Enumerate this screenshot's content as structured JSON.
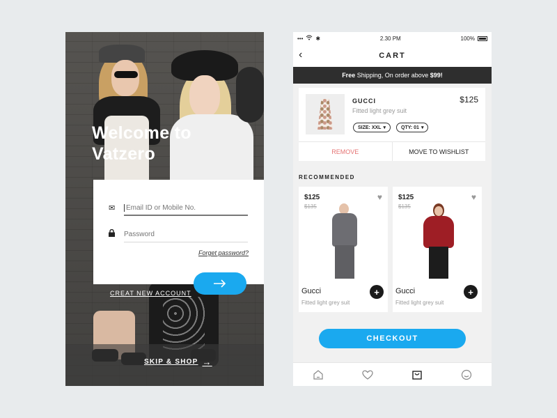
{
  "login": {
    "welcome_line1": "Welcome to",
    "welcome_line2": "Vatzero",
    "email_placeholder": "Email ID or Mobile No.",
    "password_placeholder": "Password",
    "forgot_label": "Forget password?",
    "submit_icon": "arrow-right-icon",
    "create_account_label": "CREAT NEW ACCOUNT",
    "skip_label": "SKIP & SHOP"
  },
  "status_bar": {
    "time": "2.30 PM",
    "battery": "100%"
  },
  "cart": {
    "title": "CART",
    "banner_bold1": "Free",
    "banner_text": " Shipping, On order above ",
    "banner_bold2": "$99!",
    "item": {
      "brand": "GUCCI",
      "description": "Fitted light grey suit",
      "price": "$125",
      "size_label": "SIZE: XXL",
      "qty_label": "QTY: 01",
      "remove_label": "REMOVE",
      "wishlist_label": "MOVE TO WISHLIST"
    },
    "recommended_label": "RECOMMENDED",
    "recommended": [
      {
        "price": "$125",
        "old_price": "$135",
        "name": "Gucci",
        "description": "Fitted light grey suit"
      },
      {
        "price": "$125",
        "old_price": "$135",
        "name": "Gucci",
        "description": "Fitted light grey suit"
      }
    ],
    "checkout_label": "CHECKOUT"
  },
  "tabs": [
    "home-icon",
    "heart-icon",
    "bag-icon",
    "profile-icon"
  ],
  "colors": {
    "accent": "#1aa9ef",
    "banner": "#2e2e2e",
    "remove": "#e57373"
  }
}
